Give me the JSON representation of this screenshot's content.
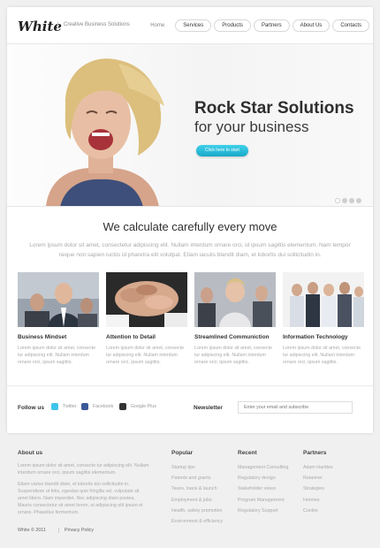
{
  "header": {
    "logo": "White",
    "tagline": "Creative Business Solutions",
    "nav": [
      {
        "label": "Home"
      },
      {
        "label": "Services"
      },
      {
        "label": "Products"
      },
      {
        "label": "Partners"
      },
      {
        "label": "About Us"
      },
      {
        "label": "Contacts"
      }
    ]
  },
  "hero": {
    "title": "Rock Star Solutions",
    "subtitle": "for your business",
    "button": "Click here to start",
    "slides": 4,
    "active_slide": 1
  },
  "intro": {
    "title": "We calculate carefully every move",
    "text": "Lorem ipsum dolor sit amet, consectetur adipiscing elit. Nullam interdum ornare orci, id ipsum sagittis elementum. Nam tempor neque non sapien iuctiis id pharetra elit volutpat. Etiam iaculis blandit diam, et lobortis dui sollicitudin in."
  },
  "features": [
    {
      "title": "Business Mindset",
      "text": "Lorem ipsum dolor sit amet, consecte tur adipiscing elit. Nullam interdum ornare orci, ipsum sagittis."
    },
    {
      "title": "Attention to Detail",
      "text": "Lorem ipsum dolor sit amet, consecte tur adipiscing elit. Nullam interdum ornare orci, ipsum sagittis."
    },
    {
      "title": "Streamlined Communiction",
      "text": "Lorem ipsum dolor sit amet, consecte tur adipiscing elit. Nullam interdum ornare orci, ipsum sagittis."
    },
    {
      "title": "Information Technology",
      "text": "Lorem ipsum dolor sit amet, consecte tur adipiscing elit. Nullam interdum ornare orci, ipsum sagittis."
    }
  ],
  "follow": {
    "label": "Follow us",
    "links": [
      {
        "label": "Twitter",
        "icon": "twitter-icon",
        "color": "#3fc3ea"
      },
      {
        "label": "Facebook",
        "icon": "facebook-icon",
        "color": "#3b5998"
      },
      {
        "label": "Google Plus",
        "icon": "google-plus-icon",
        "color": "#333333"
      }
    ]
  },
  "newsletter": {
    "label": "Newsletter",
    "placeholder": "Enter your email and subscribe"
  },
  "footer": {
    "about": {
      "heading": "About us",
      "p1": "Lorem ipsum dolor sit amet, consecte tur adipiscing elit. Nullam interdum ornare orci, ipsum sagittis elementum.",
      "p2": "Etiam varius blandit diam, et lobortis dui sollicitudin in. Suspendisse ut felis, egestas quis fringilla vel, vulputate sit amet libero. Nam imperdiet. Nec adipiscing diam postea. Mauris consectetur sit amet lorem, ut adipiscing elit ipsum et ornare. Phasellus fermentum."
    },
    "popular": {
      "heading": "Popular",
      "links": [
        "Startup tips",
        "Patents and grants",
        "Taxes, loans & launch",
        "Employment & jobs",
        "Health, safety promotion",
        "Environment & efficiency"
      ]
    },
    "recent": {
      "heading": "Recent",
      "links": [
        "Management Consulting",
        "Regulatory design",
        "Stakeholder views",
        "Program Management",
        "Regulatory Support"
      ]
    },
    "partners": {
      "heading": "Partners",
      "links": [
        "Adam Hartites",
        "Retanner",
        "Strategies",
        "Hormes",
        "Cunlee"
      ]
    },
    "copyright": "White © 2011",
    "privacy": "Privacy Policy"
  },
  "colors": {
    "accent": "#22b5d6",
    "heading": "#2e2e2e",
    "muted": "#aaaaaa"
  }
}
